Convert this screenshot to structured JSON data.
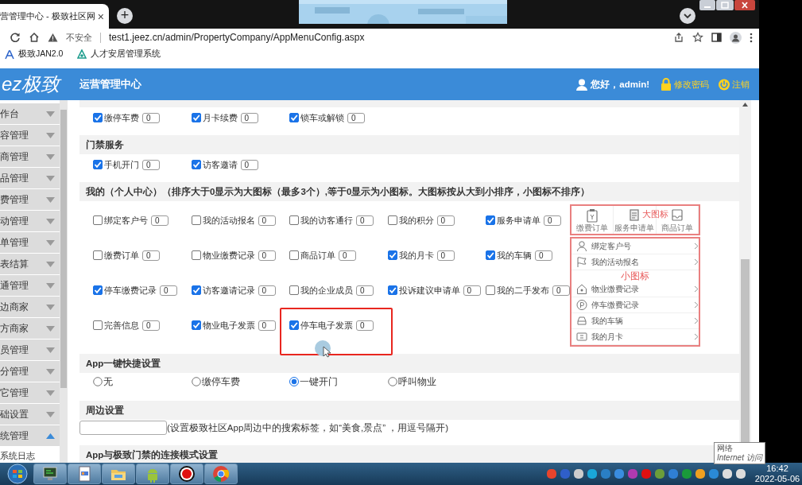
{
  "browser": {
    "tab_title": "营管理中心 - 极致社区网",
    "tab_close": "×",
    "new_tab": "+",
    "security": "不安全",
    "url": "test1.jeez.cn/admin/PropertyCompany/AppMenuConfig.aspx",
    "bookmarks": [
      {
        "kind": "font",
        "label": "极致JAN2.0"
      },
      {
        "kind": "leaf",
        "label": "人才安居管理系统"
      }
    ]
  },
  "header": {
    "logo": "ez极致",
    "title": "运营管理中心",
    "user": "您好，admin!",
    "links": [
      {
        "kind": "lock",
        "label": "修改密码"
      },
      {
        "kind": "power",
        "label": "注销"
      }
    ]
  },
  "sidebar": {
    "items": [
      {
        "label": "作台",
        "expanded": false
      },
      {
        "label": "容管理",
        "expanded": false
      },
      {
        "label": "商管理",
        "expanded": false
      },
      {
        "label": "品管理",
        "expanded": false
      },
      {
        "label": "费管理",
        "expanded": false
      },
      {
        "label": "动管理",
        "expanded": false
      },
      {
        "label": "单管理",
        "expanded": false
      },
      {
        "label": "表结算",
        "expanded": false
      },
      {
        "label": "通管理",
        "expanded": false
      },
      {
        "label": "边商家",
        "expanded": false
      },
      {
        "label": "方商家",
        "expanded": false
      },
      {
        "label": "员管理",
        "expanded": false
      },
      {
        "label": "分管理",
        "expanded": false
      },
      {
        "label": "它管理",
        "expanded": false
      },
      {
        "label": "础设置",
        "expanded": false
      },
      {
        "label": "统管理",
        "expanded": true,
        "children": [
          {
            "label": "系统日志"
          }
        ]
      }
    ]
  },
  "sections": [
    {
      "kind": "checkboxes",
      "items": [
        {
          "label": "缴停车费",
          "checked": true,
          "order": "0"
        },
        {
          "label": "月卡续费",
          "checked": true,
          "order": "0"
        },
        {
          "label": "锁车或解锁",
          "checked": true,
          "order": "0"
        }
      ]
    },
    {
      "kind": "checkboxes",
      "title": "门禁服务",
      "items": [
        {
          "label": "手机开门",
          "checked": true,
          "order": "0"
        },
        {
          "label": "访客邀请",
          "checked": true,
          "order": "0"
        }
      ]
    },
    {
      "kind": "checkboxes",
      "title": "我的（个人中心）（排序大于0显示为大图标（最多3个）,等于0显示为小图标。大图标按从大到小排序，小图标不排序）",
      "items": [
        {
          "label": "绑定客户号",
          "checked": false,
          "order": "0",
          "highlighted": false
        },
        {
          "label": "我的活动报名",
          "checked": false,
          "order": "0",
          "highlighted": false
        },
        {
          "label": "我的访客通行",
          "checked": false,
          "order": "0",
          "highlighted": false
        },
        {
          "label": "我的积分",
          "checked": false,
          "order": "0",
          "highlighted": false
        },
        {
          "label": "服务申请单",
          "checked": true,
          "order": "0",
          "highlighted": false
        },
        {
          "label": "缴费订单",
          "checked": false,
          "order": "0",
          "highlighted": false
        },
        {
          "label": "物业缴费记录",
          "checked": false,
          "order": "0",
          "highlighted": false
        },
        {
          "label": "商品订单",
          "checked": false,
          "order": "0",
          "highlighted": false
        },
        {
          "label": "我的月卡",
          "checked": true,
          "order": "0",
          "highlighted": false
        },
        {
          "label": "我的车辆",
          "checked": true,
          "order": "0",
          "highlighted": false
        },
        {
          "label": "停车缴费记录",
          "checked": true,
          "order": "0",
          "highlighted": false
        },
        {
          "label": "访客邀请记录",
          "checked": true,
          "order": "0",
          "highlighted": false
        },
        {
          "label": "我的企业成员",
          "checked": false,
          "order": "0",
          "highlighted": false
        },
        {
          "label": "投诉建议申请单",
          "checked": true,
          "order": "0",
          "highlighted": false
        },
        {
          "label": "我的二手发布",
          "checked": false,
          "order": "0",
          "highlighted": false
        },
        {
          "label": "完善信息",
          "checked": false,
          "order": "0",
          "highlighted": false
        },
        {
          "label": "物业电子发票",
          "checked": true,
          "order": "0",
          "highlighted": false
        },
        {
          "label": "停车电子发票",
          "checked": true,
          "order": "0",
          "highlighted": true
        }
      ],
      "preview": {
        "large_caption": "大图标",
        "large_icons": [
          {
            "kind": "clipboard",
            "label": "缴费订单"
          },
          {
            "kind": "document",
            "label": "服务申请单"
          },
          {
            "kind": "tray",
            "label": "商品订单"
          }
        ],
        "small_caption": "小图标",
        "small_icons": [
          {
            "kind": "person",
            "label": "绑定客户号"
          },
          {
            "kind": "flag",
            "label": "我的活动报名"
          },
          {
            "kind": "house",
            "label": "物业缴费记录"
          },
          {
            "kind": "parking",
            "label": "停车缴费记录"
          },
          {
            "kind": "car",
            "label": "我的车辆"
          },
          {
            "kind": "card",
            "label": "我的月卡"
          }
        ]
      }
    },
    {
      "kind": "radios",
      "title": "App一键快捷设置",
      "options": [
        {
          "label": "无",
          "selected": false
        },
        {
          "label": "缴停车费",
          "selected": false
        },
        {
          "label": "一键开门",
          "selected": true
        },
        {
          "label": "呼叫物业",
          "selected": false
        }
      ]
    },
    {
      "kind": "text",
      "title": "周边设置",
      "hint": "(设置极致社区App周边中的搜索标签，如“美食,景点” ，用逗号隔开)"
    },
    {
      "kind": "empty",
      "title": "App与极致门禁的连接模式设置"
    }
  ],
  "taskbar": {
    "apps": [
      {
        "kind": "computer"
      },
      {
        "kind": "document"
      },
      {
        "kind": "folder"
      },
      {
        "kind": "android"
      },
      {
        "kind": "record"
      },
      {
        "kind": "browser"
      }
    ],
    "time": "16:42",
    "date": "2022-05-06"
  },
  "tooltip": {
    "title": "网络",
    "text": "Internet 访问"
  }
}
